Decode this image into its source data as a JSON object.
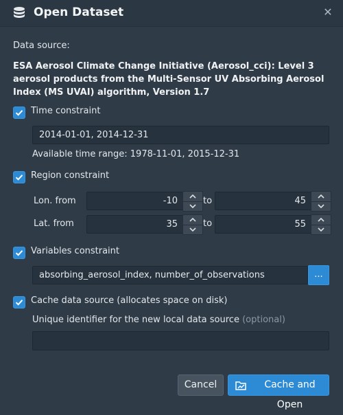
{
  "dialog": {
    "title": "Open Dataset",
    "icon": "database-icon",
    "close_glyph": "✕"
  },
  "data_source": {
    "label": "Data source:",
    "name": "ESA Aerosol Climate Change Initiative (Aerosol_cci): Level 3 aerosol products from the Multi-Sensor UV Absorbing Aerosol Index (MS UVAI) algorithm, Version 1.7"
  },
  "time": {
    "checked": true,
    "label": "Time constraint",
    "value": "2014-01-01, 2014-12-31",
    "available": "Available time range: 1978-11-01, 2015-12-31"
  },
  "region": {
    "checked": true,
    "label": "Region constraint",
    "lon_label": "Lon. from",
    "lat_label": "Lat. from",
    "to_label": "to",
    "lon_from": "-10",
    "lon_to": "45",
    "lat_from": "35",
    "lat_to": "55"
  },
  "variables": {
    "checked": true,
    "label": "Variables constraint",
    "value": "absorbing_aerosol_index, number_of_observations",
    "browse_label": "..."
  },
  "cache": {
    "checked": true,
    "label": "Cache data source (allocates space on disk)",
    "id_label": "Unique identifier for the new local data source",
    "optional": "(optional)",
    "id_value": ""
  },
  "buttons": {
    "cancel": "Cancel",
    "primary": "Cache and Open"
  },
  "colors": {
    "accent": "#2d8ad4",
    "background": "#2f3c48"
  }
}
